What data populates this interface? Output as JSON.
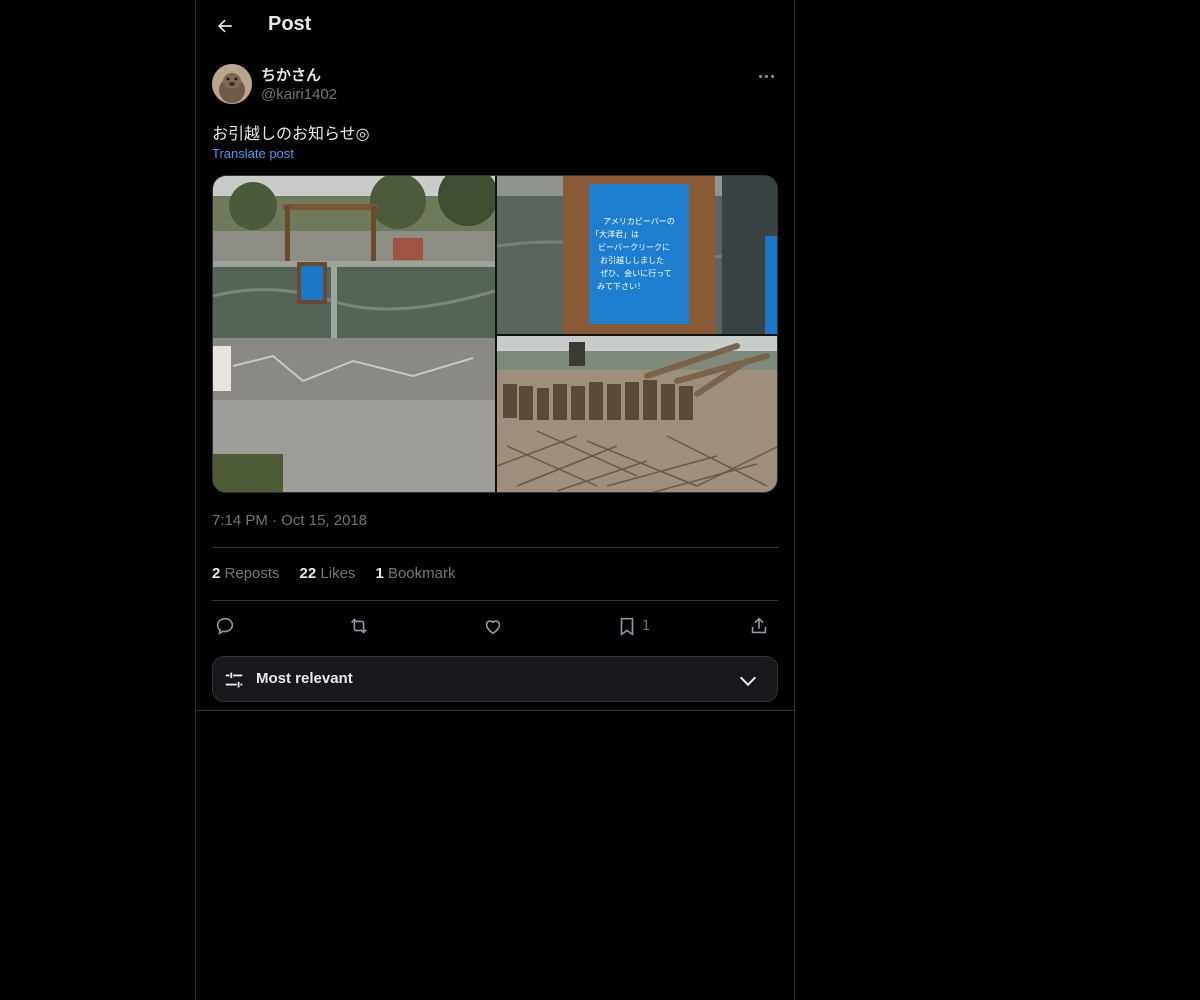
{
  "header": {
    "title": "Post",
    "back_icon": "arrow-left-icon"
  },
  "author": {
    "display_name": "ちかさん",
    "handle": "@kairi1402"
  },
  "post": {
    "text": "お引越しのお知らせ◎",
    "translate_label": "Translate post",
    "time": "7:14 PM",
    "date_separator": "·",
    "date": "Oct 15, 2018",
    "images": [
      {
        "name": "beaver-enclosure-photo"
      },
      {
        "name": "notice-sign-photo",
        "sign_text": [
          "アメリカビーバーの",
          "「大洋君」は",
          "ビーバークリークに",
          "お引越ししました",
          "ぜひ、会いに行って",
          "みて下さい！"
        ]
      },
      {
        "name": "empty-beaver-habitat-photo"
      }
    ]
  },
  "stats": {
    "reposts_count": "2",
    "reposts_label": "Reposts",
    "likes_count": "22",
    "likes_label": "Likes",
    "bookmarks_count": "1",
    "bookmarks_label": "Bookmark"
  },
  "actions": {
    "reply_icon": "reply-icon",
    "repost_icon": "repost-icon",
    "like_icon": "heart-icon",
    "bookmark_icon": "bookmark-icon",
    "bookmark_count": "1",
    "share_icon": "share-icon"
  },
  "sort": {
    "label": "Most relevant",
    "icon": "sliders-icon",
    "chevron": "chevron-down-icon"
  },
  "colors": {
    "background": "#000000",
    "text": "#e7e9ea",
    "muted": "#71767b",
    "link": "#4c9be8",
    "border": "#2f3336"
  }
}
